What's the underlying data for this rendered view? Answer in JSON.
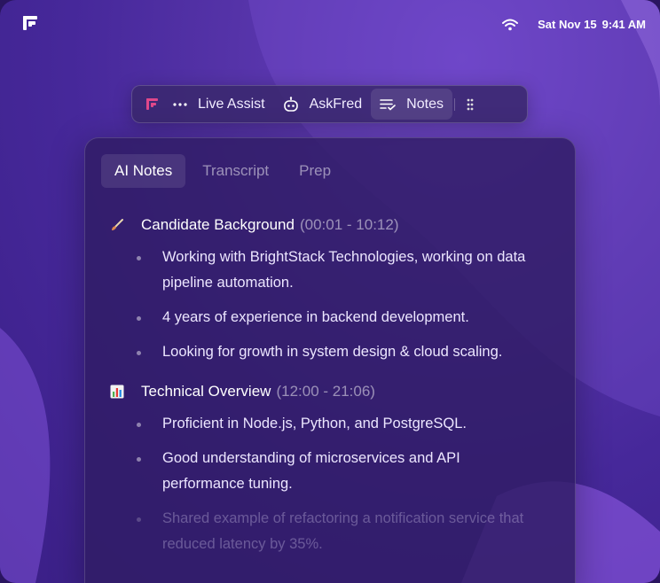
{
  "menubar": {
    "logo_icon": "fred-logo-icon",
    "wifi_icon": "wifi-icon",
    "date": "Sat Nov 15",
    "time": "9:41 AM"
  },
  "toolbar": {
    "items": [
      {
        "label": "Live Assist",
        "icon": "more-dots-icon"
      },
      {
        "label": "AskFred",
        "icon": "robot-icon"
      },
      {
        "label": "Notes",
        "icon": "notes-list-icon",
        "active": true
      }
    ],
    "drag_icon": "drag-handle-icon"
  },
  "panel": {
    "tabs": [
      {
        "label": "AI Notes",
        "active": true
      },
      {
        "label": "Transcript"
      },
      {
        "label": "Prep"
      }
    ],
    "sections": [
      {
        "icon": "paintbrush-icon",
        "title": "Candidate Background",
        "time": "(00:01 - 10:12)",
        "bullets": [
          "Working with BrightStack Technologies, working on data pipeline automation.",
          "4 years of experience in backend development.",
          "Looking for growth in system design & cloud scaling."
        ]
      },
      {
        "icon": "bar-chart-icon",
        "title": "Technical Overview",
        "time": "(12:00 - 21:06)",
        "bullets": [
          "Proficient in Node.js, Python, and PostgreSQL.",
          "Good understanding of microservices and API performance tuning.",
          "Shared example of refactoring a notification service that reduced latency by 35%."
        ]
      }
    ]
  },
  "colors": {
    "background": "#4a2a9e",
    "panel": "#301c64",
    "accent_logo": "#e0488a"
  }
}
